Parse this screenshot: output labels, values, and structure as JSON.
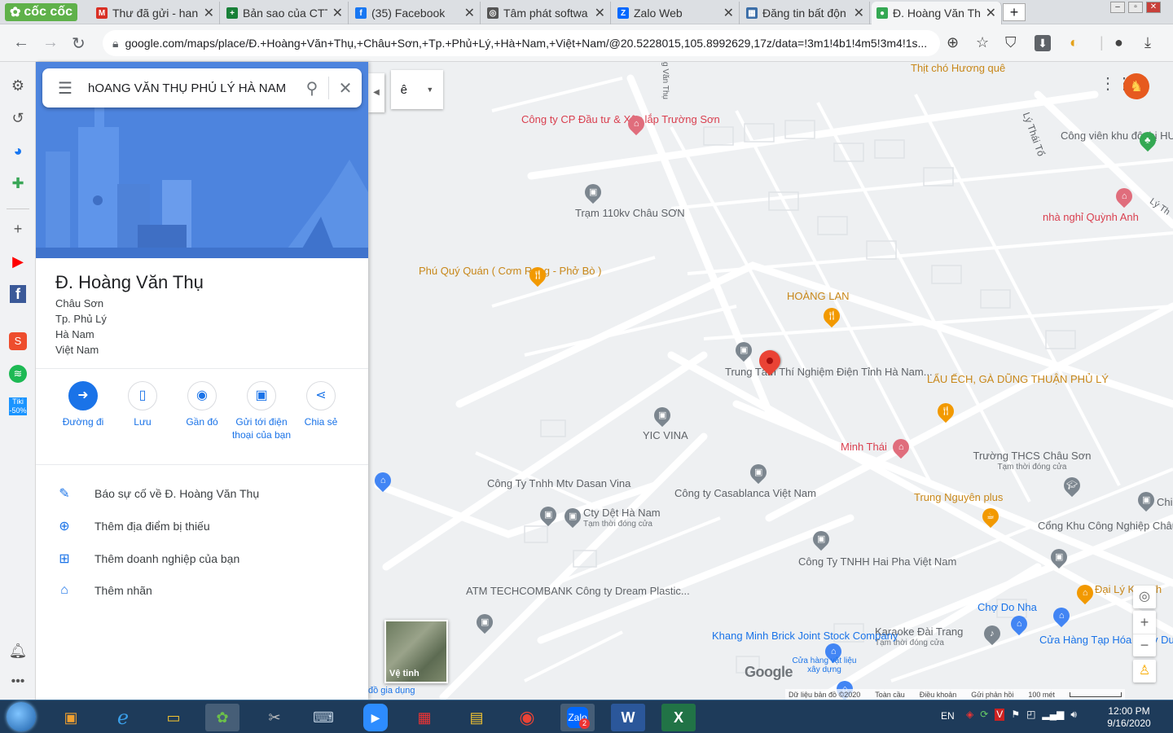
{
  "browser": {
    "brand": "cốc cốc",
    "tabs": [
      {
        "title": "Thư đã gửi - han",
        "icon": "gmail-icon",
        "color": "#d93025",
        "glyph": "M"
      },
      {
        "title": "Bản sao của CTT",
        "icon": "sheets-icon",
        "color": "#188038",
        "glyph": "+"
      },
      {
        "title": "(35) Facebook",
        "icon": "facebook-icon",
        "color": "#1877f2",
        "glyph": "f"
      },
      {
        "title": "Tâm phát softwa",
        "icon": "globe-icon",
        "color": "#555555",
        "glyph": "◎"
      },
      {
        "title": "Zalo Web",
        "icon": "zalo-icon",
        "color": "#0068ff",
        "glyph": "Z"
      },
      {
        "title": "Đăng tin bất độn",
        "icon": "page-icon",
        "color": "#3b6ea8",
        "glyph": "▦"
      },
      {
        "title": "Đ. Hoàng Văn Th",
        "icon": "maps-icon",
        "color": "#34a853",
        "glyph": "●",
        "active": true
      }
    ],
    "new_tab": "+",
    "url": "google.com/maps/place/Đ.+Hoàng+Văn+Thụ,+Châu+Sơn,+Tp.+Phủ+Lý,+Hà+Nam,+Việt+Nam/@20.5228015,105.8992629,17z/data=!3m1!4b1!4m5!3m4!1s..."
  },
  "search": {
    "query": "hOANG VĂN THỤ PHỦ LÝ HÀ NAM",
    "layer_label": "ê"
  },
  "place": {
    "title": "Đ. Hoàng Văn Thụ",
    "address": [
      "Châu Sơn",
      "Tp. Phủ Lý",
      "Hà Nam",
      "Việt Nam"
    ],
    "actions": [
      {
        "label": "Đường đi",
        "icon": "directions-icon",
        "glyph": "➜",
        "primary": true
      },
      {
        "label": "Lưu",
        "icon": "bookmark-icon",
        "glyph": "▯"
      },
      {
        "label": "Gần đó",
        "icon": "nearby-icon",
        "glyph": "◉"
      },
      {
        "label": "Gửi tới điện thoại của bạn",
        "icon": "send-to-phone-icon",
        "glyph": "▣"
      },
      {
        "label": "Chia sẻ",
        "icon": "share-icon",
        "glyph": "⋖"
      }
    ],
    "links": [
      {
        "label": "Báo sự cố về Đ. Hoàng Văn Thụ",
        "icon": "pencil-icon",
        "glyph": "✎"
      },
      {
        "label": "Thêm địa điểm bị thiếu",
        "icon": "add-location-icon",
        "glyph": "⊕"
      },
      {
        "label": "Thêm doanh nghiệp của bạn",
        "icon": "add-business-icon",
        "glyph": "⊞"
      },
      {
        "label": "Thêm nhãn",
        "icon": "label-icon",
        "glyph": "⌂"
      }
    ]
  },
  "map": {
    "pois": [
      {
        "name": "Thịt chó Hương quê",
        "color": "orange"
      },
      {
        "name": "Công ty CP Đầu tư & Xây lắp Trường Sơn",
        "color": "red"
      },
      {
        "name": "Công viên khu đô thị HUD",
        "color": "gray"
      },
      {
        "name": "Trạm 110kv Châu SƠN",
        "color": "gray"
      },
      {
        "name": "nhà nghỉ Quỳnh Anh",
        "color": "red"
      },
      {
        "name": "Phú Quý Quán ( Cơm Rang - Phở Bò )",
        "color": "orange"
      },
      {
        "name": "HOÀNG LAN",
        "color": "orange"
      },
      {
        "name": "Trung Tâm Thí Nghiệm Điện Tỉnh Hà Nam...",
        "color": "gray"
      },
      {
        "name": "LẨU ẾCH, GÀ DŨNG THUẬN PHỦ LÝ",
        "color": "orange"
      },
      {
        "name": "YIC VINA",
        "color": "gray"
      },
      {
        "name": "Minh Thái",
        "color": "red"
      },
      {
        "name": "Trường THCS Châu Sơn",
        "color": "gray",
        "sub": "Tạm thời đóng cửa"
      },
      {
        "name": "Công Ty Tnhh Mtv Dasan Vina",
        "color": "gray"
      },
      {
        "name": "Cty Dệt Hà Nam",
        "color": "gray",
        "sub": "Tạm thời đóng cửa"
      },
      {
        "name": "Công ty Casablanca Việt Nam",
        "color": "gray"
      },
      {
        "name": "Trung Nguyên plus",
        "color": "orange"
      },
      {
        "name": "Chi",
        "color": "gray"
      },
      {
        "name": "Cổng Khu Công Nghiệp Châu Sơn",
        "color": "gray"
      },
      {
        "name": "Công Ty TNHH Hai Pha Việt Nam",
        "color": "gray"
      },
      {
        "name": "ATM TECHCOMBANK Công ty Dream Plastic...",
        "color": "gray"
      },
      {
        "name": "Đại Lý Kẹo Th",
        "color": "orange"
      },
      {
        "name": "Chợ Do Nha",
        "color": "blue"
      },
      {
        "name": "Karaoke Đài Trang",
        "color": "gray",
        "sub": "Tạm thời đóng cửa"
      },
      {
        "name": "Cửa Hàng Tạp Hóa Thủy Dung",
        "color": "blue"
      },
      {
        "name": "Khang Minh Brick Joint Stock Company",
        "color": "blue"
      },
      {
        "name": "Cửa hàng vật liệu xây dựng",
        "color": "gray"
      },
      {
        "name": "đồ gia dụng",
        "color": "blue"
      }
    ],
    "streets": [
      "Lý Thái Tổ",
      "Lý Th",
      "g Văn Thụ"
    ],
    "satellite_label": "Vệ tinh",
    "google_logo": "Google",
    "footer": [
      "Dữ liệu bản đồ ©2020",
      "Toàn cầu",
      "Điều khoản",
      "Gửi phản hồi",
      "100 mét"
    ]
  },
  "taskbar": {
    "lang": "EN",
    "time": "12:00 PM",
    "date": "9/16/2020",
    "zalo_badge": "2"
  },
  "colors": {
    "accent": "#1a73e8",
    "pin": "#ea4335",
    "hero": "#4a7fd9"
  }
}
